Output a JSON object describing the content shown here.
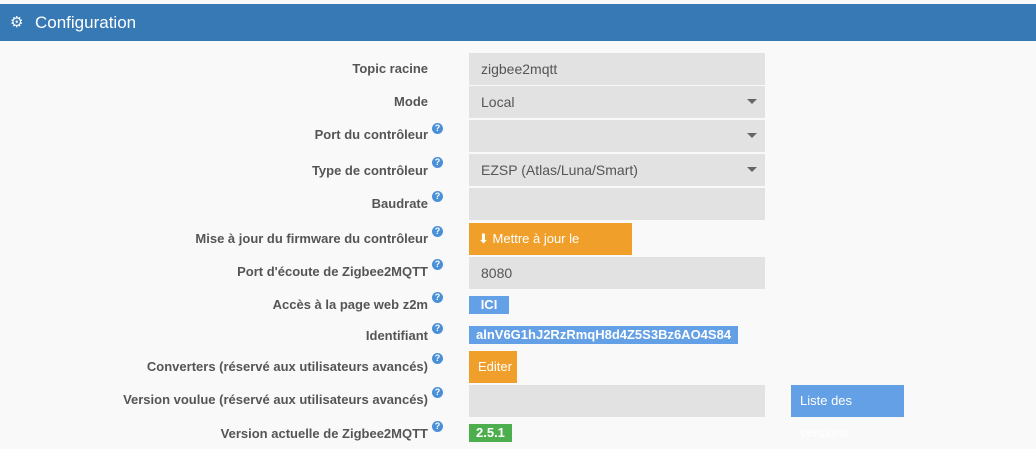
{
  "header": {
    "title": "Configuration",
    "icon": "cogs-icon"
  },
  "rows": [
    {
      "label": "Topic racine",
      "value": "zigbee2mqtt"
    },
    {
      "label": "Mode",
      "value": "Local"
    },
    {
      "label": "Port du contrôleur",
      "value": ""
    },
    {
      "label": "Type de contrôleur",
      "value": "EZSP (Atlas/Luna/Smart)"
    },
    {
      "label": "Baudrate",
      "value": ""
    },
    {
      "label": "Mise à jour du firmware du contrôleur",
      "button": "Mettre à jour le firmware"
    },
    {
      "label": "Port d'écoute de Zigbee2MQTT",
      "value": "8080"
    },
    {
      "label": "Accès à la page web z2m",
      "badge": "ICI"
    },
    {
      "label": "Identifiant",
      "badge": "alnV6G1hJ2RzRmqH8d4Z5S3Bz6AO4S84"
    },
    {
      "label": "Converters (réservé aux utilisateurs avancés)",
      "button": "Editer"
    },
    {
      "label": "Version voulue (réservé aux utilisateurs avancés)",
      "value": "",
      "button": "Liste des versions"
    },
    {
      "label": "Version actuelle de Zigbee2MQTT",
      "badge": "2.5.1"
    }
  ],
  "colors": {
    "header": "#3679b5",
    "orange": "#f0a02a",
    "blue": "#64a0e5",
    "green": "#4cae4c"
  }
}
